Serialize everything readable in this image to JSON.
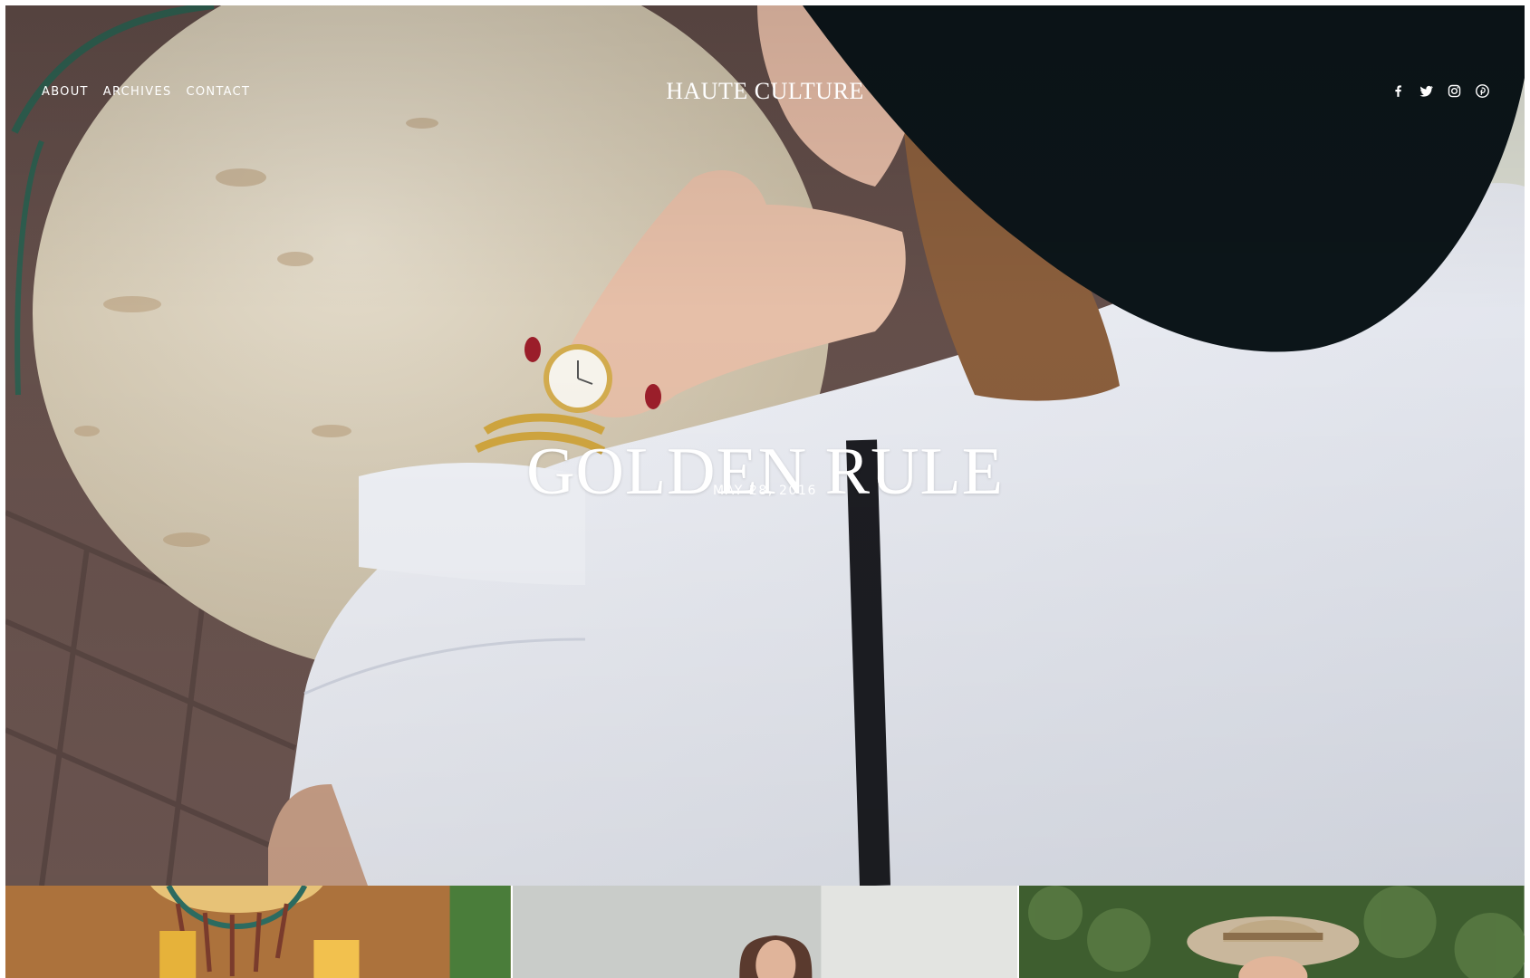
{
  "nav": {
    "items": [
      {
        "label": "ABOUT"
      },
      {
        "label": "ARCHIVES"
      },
      {
        "label": "CONTACT"
      }
    ]
  },
  "site": {
    "title": "HAUTE CULTURE"
  },
  "social": {
    "icons": [
      "facebook-icon",
      "twitter-icon",
      "instagram-icon",
      "pinterest-icon"
    ]
  },
  "hero": {
    "title": "GOLDEN RULE",
    "date": "MAY 28, 2016"
  },
  "colors": {
    "text_on_photo": "#ffffff",
    "page_background": "#ffffff"
  }
}
